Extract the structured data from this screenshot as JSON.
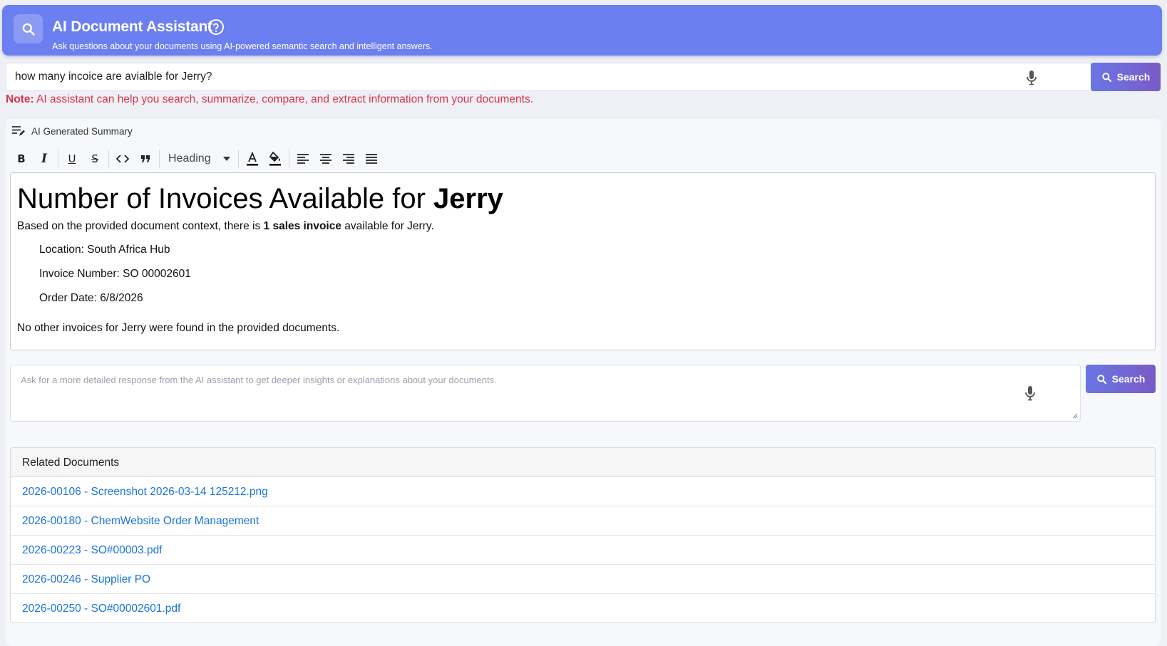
{
  "header": {
    "title": "AI Document Assistant",
    "subtitle": "Ask questions about your documents using AI-powered semantic search and intelligent answers."
  },
  "search": {
    "value": "how many incoice are avialble for Jerry?",
    "button_label": "Search"
  },
  "note": {
    "prefix": "Note:",
    "text": "AI assistant can help you search, summarize, compare, and extract information from your documents."
  },
  "summary": {
    "label": "AI Generated Summary",
    "toolbar": {
      "heading_select": "Heading"
    },
    "content": {
      "heading_part1": "Number of Invoices Available for ",
      "heading_part2": "Jerry",
      "intro_before": "Based on the provided document context, there is ",
      "intro_bold": "1 sales invoice",
      "intro_after": " available for Jerry.",
      "details": [
        "Location: South Africa Hub",
        "Invoice Number: SO 00002601",
        "Order Date: 6/8/2026"
      ],
      "outro": "No other invoices for Jerry were found in the provided documents."
    }
  },
  "followup": {
    "placeholder": "Ask for a more detailed response from the AI assistant to get deeper insights or explanations about your documents.",
    "button_label": "Search"
  },
  "related": {
    "title": "Related Documents",
    "documents": [
      "2026-00106 - Screenshot 2026-03-14 125212.png",
      "2026-00180 - ChemWebsite Order Management",
      "2026-00223 - SO#00003.pdf",
      "2026-00246 - Supplier PO",
      "2026-00250 - SO#00002601.pdf"
    ]
  },
  "colors": {
    "header_bg": "#6b7ff0",
    "button_gradient_start": "#6a76e3",
    "button_gradient_end": "#7a5bc8",
    "note_red": "#d9354a",
    "link_blue": "#1a73d9"
  },
  "icons": {
    "logo": "search-icon",
    "help": "question-circle-icon",
    "voice": "microphone-icon",
    "summary": "notes-edit-icon"
  }
}
